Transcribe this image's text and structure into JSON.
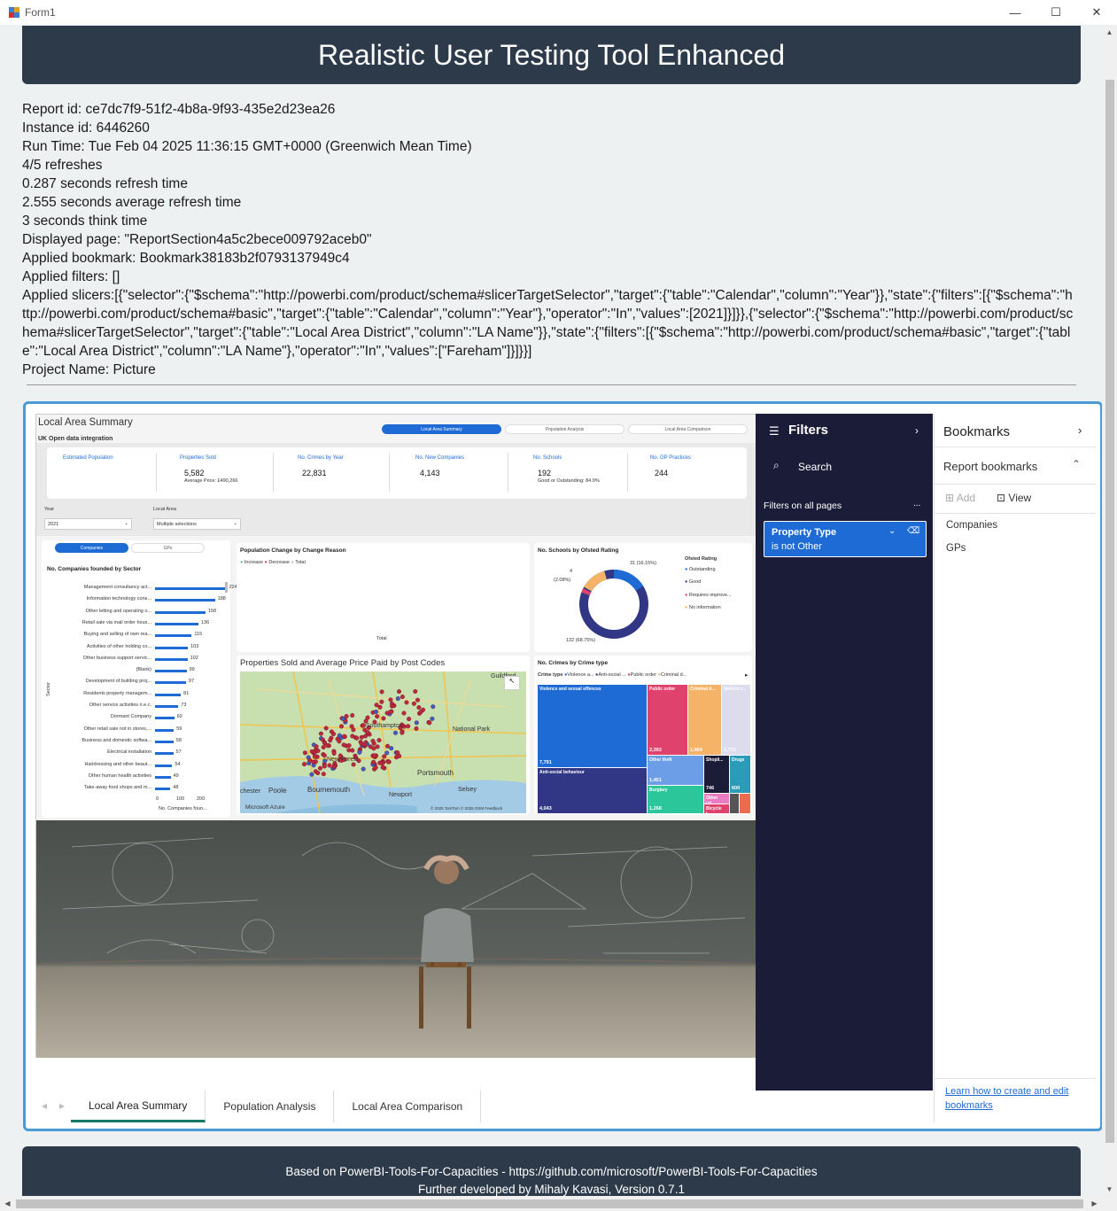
{
  "window": {
    "title": "Form1",
    "minimize": "—",
    "maximize": "☐",
    "close": "✕"
  },
  "header": {
    "title": "Realistic User Testing Tool Enhanced"
  },
  "info": {
    "report_id": "Report id: ce7dc7f9-51f2-4b8a-9f93-435e2d23ea26",
    "instance_id": "Instance id: 6446260",
    "run_time": "Run Time: Tue Feb 04 2025 11:36:15 GMT+0000 (Greenwich Mean Time)",
    "refreshes": "4/5 refreshes",
    "refresh_time": "0.287 seconds refresh time",
    "avg_refresh": "2.555 seconds average refresh time",
    "think_time": "3 seconds think time",
    "displayed_page": "Displayed page: \"ReportSection4a5c2bece009792aceb0\"",
    "applied_bookmark": "Applied bookmark: Bookmark38183b2f0793137949c4",
    "applied_filters": "Applied filters: []",
    "applied_slicers": "Applied slicers:[{\"selector\":{\"$schema\":\"http://powerbi.com/product/schema#slicerTargetSelector\",\"target\":{\"table\":\"Calendar\",\"column\":\"Year\"}},\"state\":{\"filters\":[{\"$schema\":\"http://powerbi.com/product/schema#basic\",\"target\":{\"table\":\"Calendar\",\"column\":\"Year\"},\"operator\":\"In\",\"values\":[2021]}]}},{\"selector\":{\"$schema\":\"http://powerbi.com/product/schema#slicerTargetSelector\",\"target\":{\"table\":\"Local Area District\",\"column\":\"LA Name\"}},\"state\":{\"filters\":[{\"$schema\":\"http://powerbi.com/product/schema#basic\",\"target\":{\"table\":\"Local Area District\",\"column\":\"LA Name\"},\"operator\":\"In\",\"values\":[\"Fareham\"]}]}}]",
    "project_name": "Project Name: Picture"
  },
  "report": {
    "title": "Local Area Summary",
    "subtitle": "UK Open data integration",
    "nav": [
      "Local Area Summary",
      "Population Analysis",
      "Local Area Comparison"
    ],
    "kpis": [
      {
        "title": "Estimated Population",
        "value": "",
        "sub": ""
      },
      {
        "title": "Properties Sold",
        "value": "5,582",
        "sub": "Average Price: £490,266"
      },
      {
        "title": "No. Crimes by Year",
        "value": "22,831",
        "sub": ""
      },
      {
        "title": "No. New Companies",
        "value": "4,143",
        "sub": ""
      },
      {
        "title": "No. Schools",
        "value": "192",
        "sub": "Good or Outstanding: 84.9%"
      },
      {
        "title": "No. GP Practices",
        "value": "244",
        "sub": ""
      }
    ],
    "year_label": "Year",
    "year_value": "2021",
    "area_label": "Local Area",
    "area_value": "Multiple selections",
    "toggle": [
      "Companies",
      "GPs"
    ],
    "sector_chart": {
      "title": "No. Companies founded by Sector",
      "ylabel": "Sector",
      "xlabel": "No. Companies foun...",
      "ticks": [
        "0",
        "100",
        "200"
      ],
      "labels": [
        "Management consultancy act...",
        "Information technology cons...",
        "Other letting and operating o...",
        "Retail sale via mail order hous...",
        "Buying and selling of own rea...",
        "Activities of other holding co...",
        "Other business support servic...",
        "(Blank)",
        "Development of building proj...",
        "Residents property managem...",
        "Other service activities n.e.c.",
        "Dormant Company",
        "Other retail sale not in stores,...",
        "Business and domestic softwa...",
        "Electrical installation",
        "Hairdressing and other beaut...",
        "Other human health activities",
        "Take-away food shops and m..."
      ],
      "values": [
        224,
        188,
        158,
        136,
        115,
        103,
        102,
        99,
        97,
        81,
        73,
        60,
        59,
        58,
        57,
        54,
        49,
        48
      ]
    },
    "population_chart": {
      "title": "Population Change by Change Reason",
      "legend": [
        "Increase",
        "Decrease",
        "Total"
      ],
      "xlabel": "Total"
    },
    "schools_chart": {
      "title": "No. Schools by Ofsted Rating",
      "legend_title": "Ofsted Rating",
      "legend": [
        "Outstanding",
        "Good",
        "Requires improve...",
        "No information"
      ],
      "label_top": "31 (16.15%)",
      "label_left_a": "4",
      "label_left_b": "(2.08%)",
      "label_bottom": "132 (68.75%)"
    },
    "map": {
      "title": "Properties Sold and Average Price Paid by Post Codes",
      "places": [
        "Southampton",
        "Portsmouth",
        "New Forest",
        "Bournemouth",
        "Poole",
        "Newport",
        "Selsey",
        "Guildford",
        "National Park",
        "chester"
      ],
      "brand": "Microsoft Azure",
      "credit": "© 2025 TomTom  © 2025 OSM  Feedback"
    },
    "crime_chart": {
      "title": "No. Crimes by Crime type",
      "legend_title": "Crime type",
      "legend": [
        "Violence a...",
        "Anti-social ...",
        "Public order",
        "Criminal d..."
      ],
      "tiles": [
        {
          "label": "Violence and sexual offences",
          "value": "7,791"
        },
        {
          "label": "Anti-social behaviour",
          "value": "4,043"
        },
        {
          "label": "Public order",
          "value": "2,393"
        },
        {
          "label": "Criminal d...",
          "value": "1,969"
        },
        {
          "label": "Vehicle c...",
          "value": "1,772"
        },
        {
          "label": "Other theft",
          "value": "1,451"
        },
        {
          "label": "Burglary",
          "value": "1,268"
        },
        {
          "label": "Shopli...",
          "value": "746"
        },
        {
          "label": "Drugs",
          "value": "600"
        },
        {
          "label": "Other cri...",
          "value": ""
        },
        {
          "label": "Bicycle t...",
          "value": ""
        }
      ]
    },
    "tabs": [
      "Local Area Summary",
      "Population Analysis",
      "Local Area Comparison"
    ]
  },
  "filters_pane": {
    "title": "Filters",
    "search": "Search",
    "section": "Filters on all pages",
    "more": "...",
    "card_title": "Property Type",
    "card_sub": "is not Other"
  },
  "bookmarks_pane": {
    "title": "Bookmarks",
    "section": "Report bookmarks",
    "add": "Add",
    "view": "View",
    "items": [
      "Companies",
      "GPs"
    ],
    "learn": "Learn how to create and edit bookmarks"
  },
  "footer": {
    "line1": "Based on PowerBI-Tools-For-Capacities - https://github.com/microsoft/PowerBI-Tools-For-Capacities",
    "line2": "Further developed by Mihaly Kavasi, Version 0.7.1"
  },
  "colors": {
    "header_bg": "#2d3a4a",
    "accent": "#1e6bd6",
    "filters_bg": "#1b1c38",
    "tab_active": "#117865"
  }
}
